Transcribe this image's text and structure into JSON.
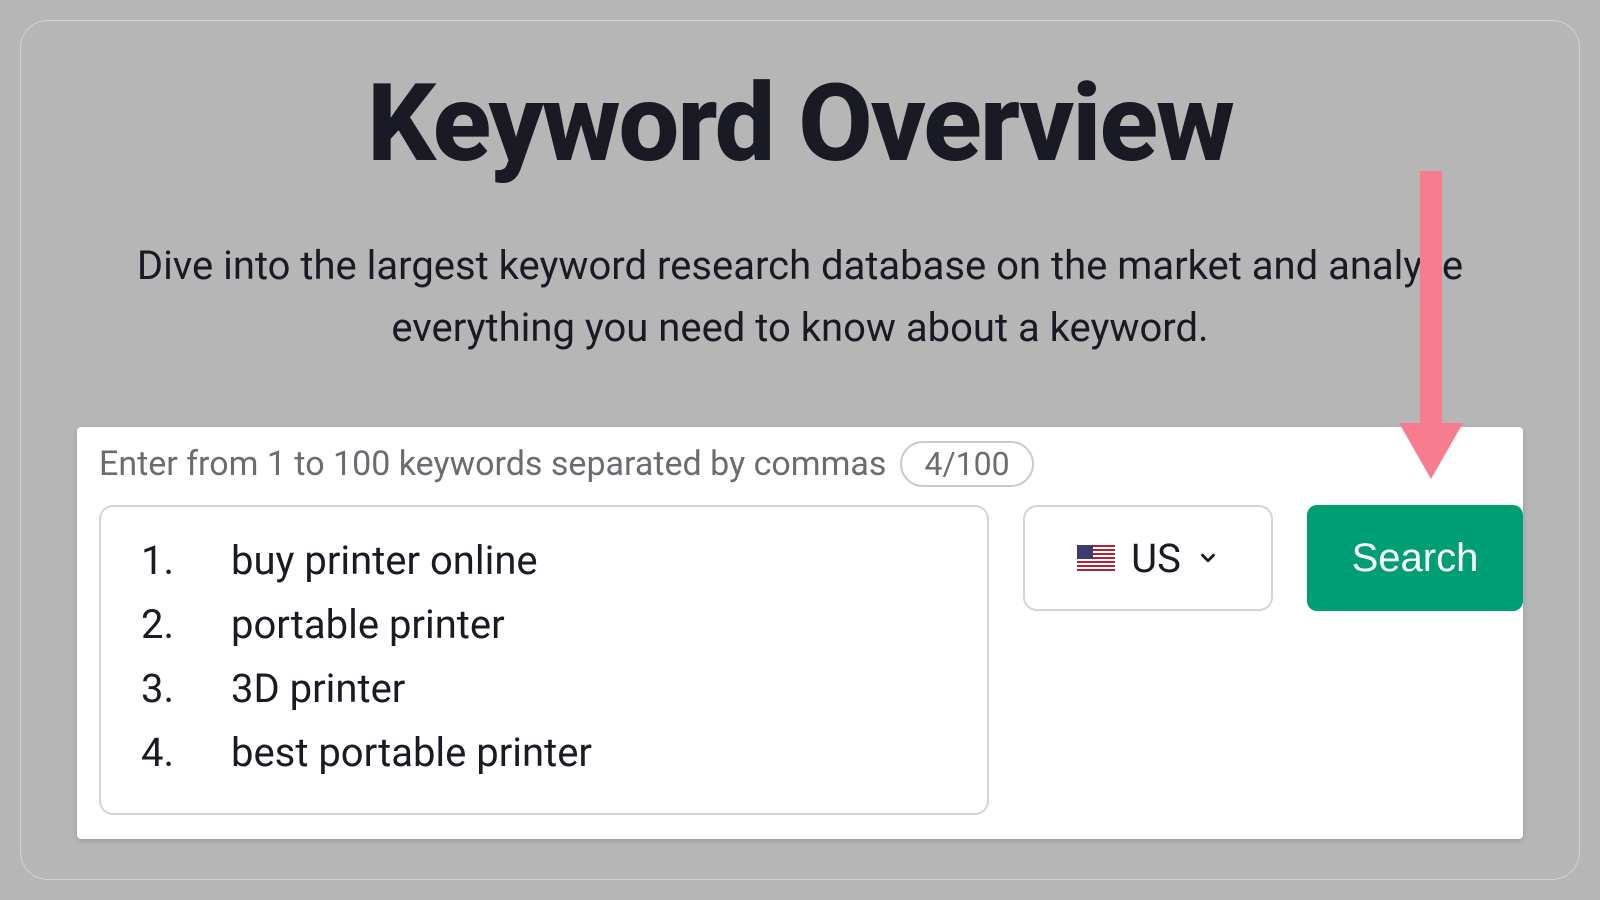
{
  "header": {
    "title": "Keyword Overview",
    "subtitle": "Dive into the largest keyword research database on the market and analyze everything you need to know about a keyword."
  },
  "search": {
    "helper_text": "Enter from 1 to 100 keywords separated by commas",
    "count_label": "4/100",
    "keywords": [
      "buy printer online",
      "portable printer",
      "3D printer",
      "best portable printer"
    ],
    "country_label": "US",
    "search_button_label": "Search"
  },
  "colors": {
    "accent": "#009e74",
    "arrow": "#f77d8e"
  }
}
